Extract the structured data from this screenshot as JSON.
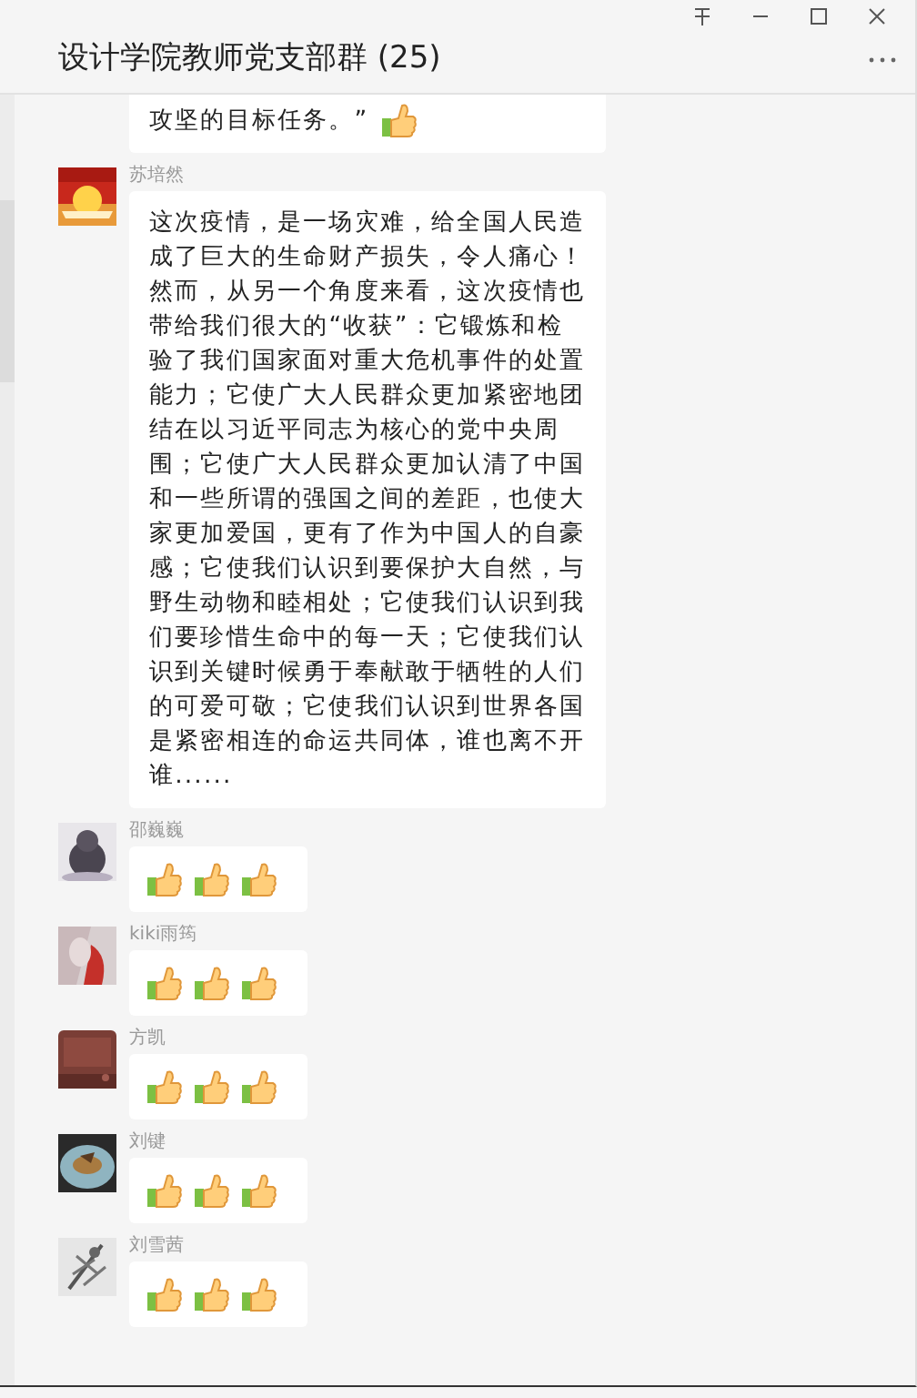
{
  "window": {
    "title": "设计学院教师党支部群 (25)"
  },
  "messages": [
    {
      "content": [
        {
          "kind": "text",
          "text": "攻坚的目标任务。”"
        },
        {
          "kind": "thumbs_up"
        }
      ]
    },
    {
      "sender": "苏培然",
      "content": [
        {
          "kind": "text",
          "text": "这次疫情，是一场灾难，给全国人民造成了巨大的生命财产损失，令人痛心！然而，从另一个角度来看，这次疫情也带给我们很大的“收获”：它锻炼和检验了我们国家面对重大危机事件的处置能力；它使广大人民群众更加紧密地团结在以习近平同志为核心的党中央周围；它使广大人民群众更加认清了中国和一些所谓的强国之间的差距，也使大家更加爱国，更有了作为中国人的自豪感；它使我们认识到要保护大自然，与野生动物和睦相处；它使我们认识到我们要珍惜生命中的每一天；它使我们认识到关键时候勇于奉献敢于牺牲的人们的可爱可敬；它使我们认识到世界各国是紧密相连的命运共同体，谁也离不开谁......"
        }
      ]
    },
    {
      "sender": "邵巍巍",
      "content": [
        {
          "kind": "thumbs_up"
        },
        {
          "kind": "thumbs_up"
        },
        {
          "kind": "thumbs_up"
        }
      ]
    },
    {
      "sender": "kiki雨筠",
      "content": [
        {
          "kind": "thumbs_up"
        },
        {
          "kind": "thumbs_up"
        },
        {
          "kind": "thumbs_up"
        }
      ]
    },
    {
      "sender": "方凯",
      "content": [
        {
          "kind": "thumbs_up"
        },
        {
          "kind": "thumbs_up"
        },
        {
          "kind": "thumbs_up"
        }
      ]
    },
    {
      "sender": "刘键",
      "content": [
        {
          "kind": "thumbs_up"
        },
        {
          "kind": "thumbs_up"
        },
        {
          "kind": "thumbs_up"
        }
      ]
    },
    {
      "sender": "刘雪茜",
      "content": [
        {
          "kind": "thumbs_up"
        },
        {
          "kind": "thumbs_up"
        },
        {
          "kind": "thumbs_up"
        }
      ]
    }
  ]
}
